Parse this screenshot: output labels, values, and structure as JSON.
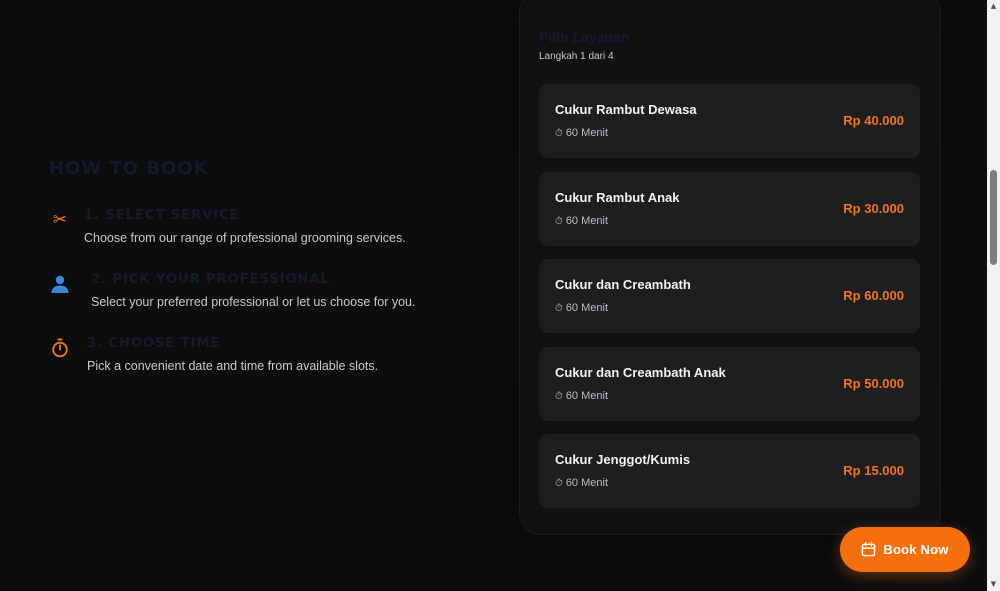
{
  "how_to_book": {
    "title": "HOW TO BOOK",
    "steps": [
      {
        "icon": "scissors-icon",
        "title": "1. SELECT SERVICE",
        "description": "Choose from our range of professional grooming services."
      },
      {
        "icon": "person-icon",
        "title": "2. PICK YOUR PROFESSIONAL",
        "description": "Select your preferred professional or let us choose for you."
      },
      {
        "icon": "stopwatch-icon",
        "title": "3. CHOOSE TIME",
        "description": "Pick a convenient date and time from available slots."
      }
    ]
  },
  "panel": {
    "title": "Pilih Layanan",
    "subtitle": "Langkah 1 dari 4",
    "services": [
      {
        "name": "Cukur Rambut Dewasa",
        "duration": "60 Menit",
        "price": "Rp 40.000"
      },
      {
        "name": "Cukur Rambut Anak",
        "duration": "60 Menit",
        "price": "Rp 30.000"
      },
      {
        "name": "Cukur dan Creambath",
        "duration": "60 Menit",
        "price": "Rp 60.000"
      },
      {
        "name": "Cukur dan Creambath Anak",
        "duration": "60 Menit",
        "price": "Rp 50.000"
      },
      {
        "name": "Cukur Jenggot/Kumis",
        "duration": "60 Menit",
        "price": "Rp 15.000"
      }
    ]
  },
  "book_button": {
    "label": "Book Now",
    "icon": "calendar-icon"
  },
  "colors": {
    "accent": "#f56f0e",
    "price": "#f2741a",
    "background": "#0d0d0e",
    "card": "#1e1e20",
    "heading_dark_navy": "#141c30"
  }
}
